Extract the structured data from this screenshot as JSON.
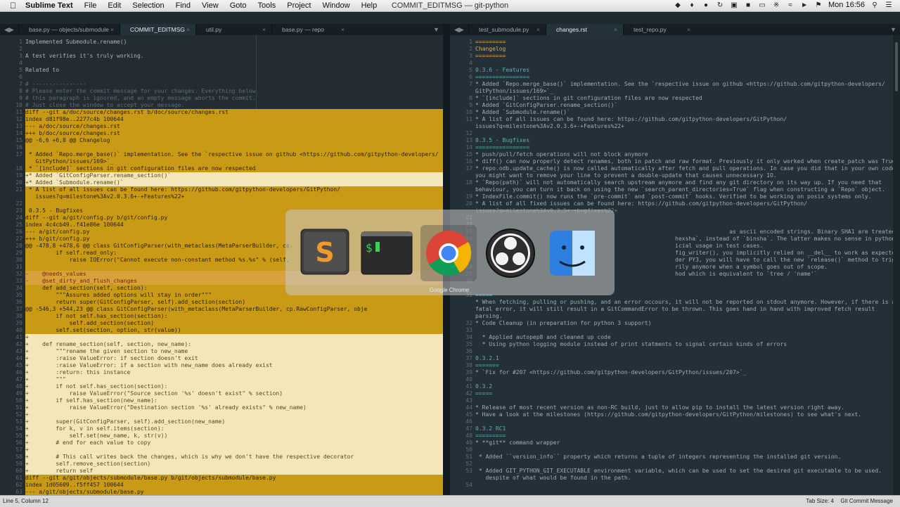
{
  "menubar": {
    "apple": "",
    "app_name": "Sublime Text",
    "menus": [
      "File",
      "Edit",
      "Selection",
      "Find",
      "View",
      "Goto",
      "Tools",
      "Project",
      "Window",
      "Help"
    ],
    "window_title": "COMMIT_EDITMSG — git-python",
    "clock": "Mon 16:56"
  },
  "left_tabs": [
    "base.py — objects/submodule",
    "COMMIT_EDITMSG",
    "util.py",
    "base.py — repo"
  ],
  "right_tabs": [
    "test_submodule.py",
    "changes.rst",
    "test_repo.py"
  ],
  "left_lines": [
    {
      "n": "1",
      "t": "Implemented Submodule.rename()",
      "c": ""
    },
    {
      "n": "2",
      "t": "",
      "c": ""
    },
    {
      "n": "3",
      "t": "A test verifies it's truly working.",
      "c": ""
    },
    {
      "n": "4",
      "t": "",
      "c": ""
    },
    {
      "n": "5",
      "t": "Related to",
      "c": ""
    },
    {
      "n": "6",
      "t": "",
      "c": ""
    },
    {
      "n": "7",
      "t": "# ----------------",
      "c": "comment"
    },
    {
      "n": "8",
      "t": "# Please enter the commit message for your changes. Everything below",
      "c": "comment"
    },
    {
      "n": "9",
      "t": "# this paragraph is ignored, and an empty message aborts the commit.",
      "c": "comment"
    },
    {
      "n": "10",
      "t": "# Just close the window to accept your message.",
      "c": "comment"
    },
    {
      "n": "11",
      "t": "diff --git a/doc/source/changes.rst b/doc/source/changes.rst",
      "c": "hl"
    },
    {
      "n": "12",
      "t": "index d81f98e..2277c4b 100644",
      "c": "hl"
    },
    {
      "n": "13",
      "t": "--- a/doc/source/changes.rst",
      "c": "hl"
    },
    {
      "n": "14",
      "t": "+++ b/doc/source/changes.rst",
      "c": "hl"
    },
    {
      "n": "15",
      "t": "@@ -6,6 +6,8 @@ Changelog",
      "c": "hl"
    },
    {
      "n": "16",
      "t": "",
      "c": "hl"
    },
    {
      "n": "17",
      "t": " * Added `Repo.merge_base()` implementation. See the `respective issue on github <https://github.com/gitpython-developers/",
      "c": "hl"
    },
    {
      "n": "",
      "t": "   GitPython/issues/169>`_",
      "c": "hl"
    },
    {
      "n": "18",
      "t": " * `[include]` sections in git configuration files are now respected",
      "c": "hl"
    },
    {
      "n": "19",
      "t": "+* Added `GitConfigParser.rename_section()`",
      "c": "hl lt"
    },
    {
      "n": "20",
      "t": "+* Added `Submodule.rename()`",
      "c": "hl lt"
    },
    {
      "n": "21",
      "t": " * A list of all issues can be found here: https://github.com/gitpython-developers/GitPython/",
      "c": "hl"
    },
    {
      "n": "",
      "t": "   issues?q=milestone%3Av2.0.3.6+-+Features%22+",
      "c": "hl"
    },
    {
      "n": "22",
      "t": "",
      "c": "hl"
    },
    {
      "n": "23",
      "t": " 0.3.5 - Bugfixes",
      "c": "hl"
    },
    {
      "n": "24",
      "t": "diff --git a/git/config.py b/git/config.py",
      "c": "hl"
    },
    {
      "n": "25",
      "t": "index 4c4cb49..f41e86e 100644",
      "c": "hl"
    },
    {
      "n": "26",
      "t": "--- a/git/config.py",
      "c": "hl"
    },
    {
      "n": "27",
      "t": "+++ b/git/config.py",
      "c": "hl"
    },
    {
      "n": "28",
      "t": "@@ -478,8 +478,6 @@ class GitConfigParser(with_metaclass(MetaParserBuilder, cp.",
      "c": "hl"
    },
    {
      "n": "29",
      "t": "         if self.read_only:",
      "c": "hl"
    },
    {
      "n": "30",
      "t": "             raise IOError(\"Cannot execute non-constant method %s.%s\" % (self,",
      "c": "hl"
    },
    {
      "n": "31",
      "t": "",
      "c": "hl"
    },
    {
      "n": "32",
      "t": "-    @needs_values",
      "c": "hl red"
    },
    {
      "n": "33",
      "t": "-    @set_dirty_and_flush_changes",
      "c": "hl red"
    },
    {
      "n": "34",
      "t": "     def add_section(self, section):",
      "c": "hl"
    },
    {
      "n": "35",
      "t": "         \"\"\"Assures added options will stay in order\"\"\"",
      "c": "hl"
    },
    {
      "n": "36",
      "t": "         return super(GitConfigParser, self).add_section(section)",
      "c": "hl"
    },
    {
      "n": "37",
      "t": "@@ -546,3 +544,23 @@ class GitConfigParser(with_metaclass(MetaParserBuilder, cp.RawConfigParser, obje",
      "c": "hl"
    },
    {
      "n": "38",
      "t": "         if not self.has_section(section):",
      "c": "hl"
    },
    {
      "n": "39",
      "t": "             self.add_section(section)",
      "c": "hl"
    },
    {
      "n": "40",
      "t": "         self.set(section, option, str(value))",
      "c": "hl"
    },
    {
      "n": "41",
      "t": "+",
      "c": "hl lt"
    },
    {
      "n": "42",
      "t": "+    def rename_section(self, section, new_name):",
      "c": "hl lt"
    },
    {
      "n": "43",
      "t": "+        \"\"\"rename the given section to new_name",
      "c": "hl lt"
    },
    {
      "n": "44",
      "t": "+        :raise ValueError: if section doesn't exit",
      "c": "hl lt"
    },
    {
      "n": "45",
      "t": "+        :raise ValueError: if a section with new_name does already exist",
      "c": "hl lt"
    },
    {
      "n": "46",
      "t": "+        :return: this instance",
      "c": "hl lt"
    },
    {
      "n": "47",
      "t": "+        \"\"\"",
      "c": "hl lt"
    },
    {
      "n": "48",
      "t": "+        if not self.has_section(section):",
      "c": "hl lt"
    },
    {
      "n": "49",
      "t": "+            raise ValueError(\"Source section '%s' doesn't exist\" % section)",
      "c": "hl lt"
    },
    {
      "n": "50",
      "t": "+        if self.has_section(new_name):",
      "c": "hl lt"
    },
    {
      "n": "51",
      "t": "+            raise ValueError(\"Destination section '%s' already exists\" % new_name)",
      "c": "hl lt"
    },
    {
      "n": "52",
      "t": "+",
      "c": "hl lt"
    },
    {
      "n": "53",
      "t": "+        super(GitConfigParser, self).add_section(new_name)",
      "c": "hl lt"
    },
    {
      "n": "54",
      "t": "+        for k, v in self.items(section):",
      "c": "hl lt"
    },
    {
      "n": "55",
      "t": "+            self.set(new_name, k, str(v))",
      "c": "hl lt"
    },
    {
      "n": "56",
      "t": "+        # end for each value to copy",
      "c": "hl lt"
    },
    {
      "n": "57",
      "t": "+",
      "c": "hl lt"
    },
    {
      "n": "58",
      "t": "+        # This call writes back the changes, which is why we don't have the respective decorator",
      "c": "hl lt"
    },
    {
      "n": "59",
      "t": "+        self.remove_section(section)",
      "c": "hl lt"
    },
    {
      "n": "60",
      "t": "+        return self",
      "c": "hl lt"
    },
    {
      "n": "61",
      "t": "diff --git a/git/objects/submodule/base.py b/git/objects/submodule/base.py",
      "c": "hl"
    },
    {
      "n": "62",
      "t": "index 1d05609..f5ff457 100644",
      "c": "hl"
    },
    {
      "n": "63",
      "t": "--- a/git/objects/submodule/base.py",
      "c": "hl"
    }
  ],
  "right_lines": [
    {
      "n": "1",
      "t": "=========",
      "c": "orange"
    },
    {
      "n": "2",
      "t": "Changelog",
      "c": "orange"
    },
    {
      "n": "3",
      "t": "=========",
      "c": "orange"
    },
    {
      "n": "4",
      "t": "",
      "c": ""
    },
    {
      "n": "5",
      "t": "0.3.6 - Features",
      "c": "teal"
    },
    {
      "n": "6",
      "t": "================",
      "c": "teal"
    },
    {
      "n": "7",
      "t": "* Added `Repo.merge_base()` implementation. See the `respective issue on github <https://github.com/gitpython-developers/",
      "c": ""
    },
    {
      "n": "",
      "t": "GitPython/issues/169>`_",
      "c": ""
    },
    {
      "n": "8",
      "t": "* `[include]` sections in git configuration files are now respected",
      "c": ""
    },
    {
      "n": "9",
      "t": "* Added `GitConfigParser.rename_section()`",
      "c": ""
    },
    {
      "n": "10",
      "t": "* Added `Submodule.rename()`",
      "c": ""
    },
    {
      "n": "11",
      "t": "* A list of all issues can be found here: https://github.com/gitpython-developers/GitPython/",
      "c": ""
    },
    {
      "n": "",
      "t": "issues?q=milestone%3Av2.0.3.6+-+Features%22+",
      "c": ""
    },
    {
      "n": "12",
      "t": "",
      "c": ""
    },
    {
      "n": "13",
      "t": "0.3.5 - Bugfixes",
      "c": "teal"
    },
    {
      "n": "14",
      "t": "================",
      "c": "teal"
    },
    {
      "n": "15",
      "t": "* push/pull/fetch operations will not block anymore",
      "c": ""
    },
    {
      "n": "16",
      "t": "* diff() can now properly detect renames, both in patch and raw format. Previously it only worked when create_patch was True.",
      "c": ""
    },
    {
      "n": "17",
      "t": "* repo.odb.update_cache() is now called automatically after fetch and pull operations. In case you did that in your own code,",
      "c": ""
    },
    {
      "n": "",
      "t": "you might want to remove your line to prevent a double-update that causes unnecessary IO.",
      "c": ""
    },
    {
      "n": "18",
      "t": "* `Repo(path)` will not automatically search upstream anymore and find any git directory on its way up. If you need that",
      "c": ""
    },
    {
      "n": "",
      "t": "behaviour, you can turn it back on using the new `search_parent_directories=True` flag when constructing a `Repo` object.",
      "c": ""
    },
    {
      "n": "19",
      "t": "* IndexFile.commit() now runs the `pre-commit` and `post-commit` hooks. Verified to be working on posix systems only.",
      "c": ""
    },
    {
      "n": "20",
      "t": "* A list of all fixed issues can be found here: https://github.com/gitpython-developers/GitPython/",
      "c": ""
    },
    {
      "n": "",
      "t": "issues?q=milestone%3Av0.3.5+-+bugfixes%22+",
      "c": "muted"
    },
    {
      "n": "21",
      "t": "",
      "c": ""
    },
    {
      "n": "22",
      "t": "",
      "c": ""
    },
    {
      "n": "23",
      "t": "                                                                           as ascii encoded strings. Binary SHA1 are treated as bytes.",
      "c": ""
    },
    {
      "n": "24",
      "t": "                                                           hexsha`, instead of `binsha`. The latter makes no sense in python 3 and I see no",
      "c": ""
    },
    {
      "n": "25",
      "t": "                                                           icial usage in test cases.",
      "c": ""
    },
    {
      "n": "26",
      "t": "                                                           fig_writer(), you implicitly relied on __del__ to work as expected to flush",
      "c": ""
    },
    {
      "n": "27",
      "t": "                                                           der PY3, you will have to call the new `release()` method to trigger a flush. For",
      "c": ""
    },
    {
      "n": "28",
      "t": "                                                           rily anymore when a symbol goes out of scope.",
      "c": ""
    },
    {
      "n": "29",
      "t": "                                                           hod which is equivalent to `tree / 'name'`",
      "c": ""
    },
    {
      "n": "30",
      "t": "",
      "c": ""
    },
    {
      "n": "",
      "t": "",
      "c": ""
    },
    {
      "n": "31",
      "t": "=====",
      "c": "teal"
    },
    {
      "n": "",
      "t": "* When fetching, pulling or pushing, and an error occours, it will not be reported on stdout anymore. However, if there is a",
      "c": ""
    },
    {
      "n": "",
      "t": "fatal error, it will still result in a GitCommandError to be thrown. This goes hand in hand with improved fetch result",
      "c": ""
    },
    {
      "n": "",
      "t": "parsing.",
      "c": ""
    },
    {
      "n": "32",
      "t": "* Code Cleanup (in preparation for python 3 support)",
      "c": ""
    },
    {
      "n": "33",
      "t": "",
      "c": ""
    },
    {
      "n": "34",
      "t": "  * Applied autopep8 and cleaned up code",
      "c": ""
    },
    {
      "n": "35",
      "t": "  * Using python logging module instead of print statments to signal certain kinds of errors",
      "c": ""
    },
    {
      "n": "36",
      "t": "",
      "c": ""
    },
    {
      "n": "37",
      "t": "0.3.2.1",
      "c": "teal"
    },
    {
      "n": "38",
      "t": "=======",
      "c": "teal"
    },
    {
      "n": "39",
      "t": "* `Fix for #207 <https://github.com/gitpython-developers/GitPython/issues/207>`_",
      "c": ""
    },
    {
      "n": "40",
      "t": "",
      "c": ""
    },
    {
      "n": "41",
      "t": "0.3.2",
      "c": "teal"
    },
    {
      "n": "42",
      "t": "=====",
      "c": "teal"
    },
    {
      "n": "43",
      "t": "",
      "c": ""
    },
    {
      "n": "44",
      "t": "* Release of most recent version as non-RC build, just to allow pip to install the latest version right away.",
      "c": ""
    },
    {
      "n": "45",
      "t": "* Have a look at the milestones (https://github.com/gitpython-developers/GitPython/milestones) to see what's next.",
      "c": ""
    },
    {
      "n": "46",
      "t": "",
      "c": ""
    },
    {
      "n": "47",
      "t": "0.3.2 RC1",
      "c": "teal"
    },
    {
      "n": "48",
      "t": "=========",
      "c": "teal"
    },
    {
      "n": "49",
      "t": "* **git** command wrapper",
      "c": ""
    },
    {
      "n": "50",
      "t": "",
      "c": ""
    },
    {
      "n": "51",
      "t": " * Added ``version_info`` property which returns a tuple of integers representing the installed git version.",
      "c": ""
    },
    {
      "n": "52",
      "t": "",
      "c": ""
    },
    {
      "n": "53",
      "t": " * Added GIT_PYTHON_GIT_EXECUTABLE environment variable, which can be used to set the desired git executable to be used.",
      "c": ""
    },
    {
      "n": "",
      "t": "   despite of what would be found in the path.",
      "c": ""
    },
    {
      "n": "54",
      "t": "",
      "c": ""
    }
  ],
  "switcher": {
    "apps": [
      "sublime-text-icon",
      "terminal-icon",
      "chrome-icon",
      "obs-icon",
      "finder-icon"
    ],
    "selected": "chrome-icon",
    "selected_label": "Google Chrome"
  },
  "statusbar": {
    "position": "Line 5, Column 12",
    "tab_size": "Tab Size: 4",
    "syntax": "Git Commit Message"
  }
}
